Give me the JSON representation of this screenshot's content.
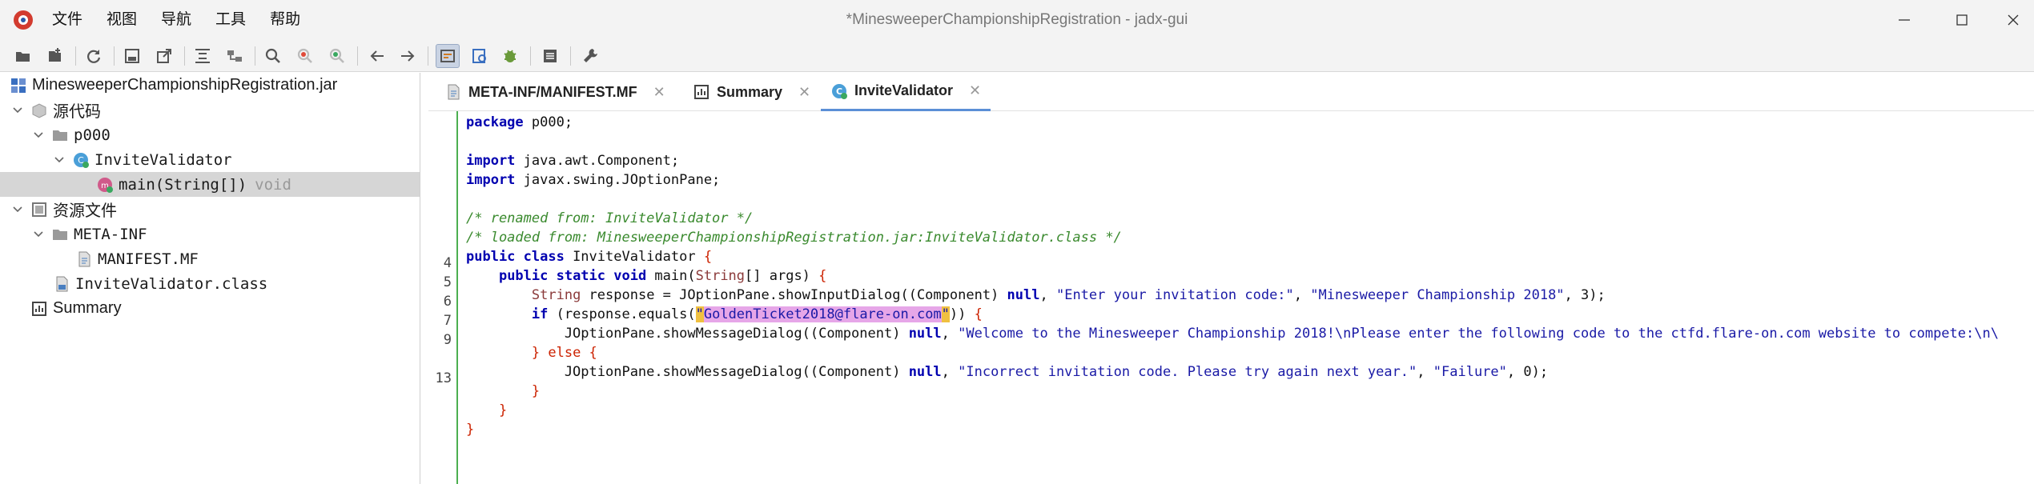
{
  "window": {
    "title": "*MinesweeperChampionshipRegistration - jadx-gui"
  },
  "menu": [
    "文件",
    "视图",
    "导航",
    "工具",
    "帮助"
  ],
  "toolbar": {
    "icons": [
      "open-file-icon",
      "add-files-icon",
      "reload-icon",
      "save-icon",
      "export-icon",
      "expand-icon",
      "sync-icon",
      "search-icon",
      "find-usage-icon",
      "goto-icon",
      "back-icon",
      "forward-icon",
      "deobfuscation-icon",
      "quick-tab-icon",
      "debug-icon",
      "log-icon",
      "preferences-icon"
    ]
  },
  "tree": {
    "root": "MinesweeperChampionshipRegistration.jar",
    "source_code": "源代码",
    "package": "p000",
    "class": "InviteValidator",
    "method": "main(String[])",
    "method_return": "void",
    "resources": "资源文件",
    "meta_inf": "META-INF",
    "manifest": "MANIFEST.MF",
    "class_file": "InviteValidator.class",
    "summary": "Summary"
  },
  "tabs": [
    {
      "label": "META-INF/MANIFEST.MF",
      "active": false
    },
    {
      "label": "Summary",
      "active": false
    },
    {
      "label": "InviteValidator",
      "active": true
    }
  ],
  "gutter": [
    "",
    "",
    "",
    "",
    "",
    "",
    "",
    "4",
    "5",
    "6",
    "7",
    "9",
    "",
    "13",
    "",
    "",
    ""
  ],
  "code": {
    "l1": [
      "package",
      " p000;"
    ],
    "l3": [
      "import",
      " java.awt.Component;"
    ],
    "l4": [
      "import",
      " javax.swing.JOptionPane;"
    ],
    "l6": "/* renamed from: InviteValidator */",
    "l7": "/* loaded from: MinesweeperChampionshipRegistration.jar:InviteValidator.class */",
    "l8": [
      "public class",
      " InviteValidator ",
      "{"
    ],
    "l9": [
      "    ",
      "public static void",
      " main(",
      "String",
      "[] args) ",
      "{"
    ],
    "l10": [
      "        ",
      "String",
      " response = JOptionPane.showInputDialog((Component) ",
      "null",
      ", ",
      "\"Enter your invitation code:\"",
      ", ",
      "\"Minesweeper Championship 2018\"",
      ", 3);"
    ],
    "l11": [
      "        ",
      "if",
      " (response.equals(",
      "\"",
      "GoldenTicket2018@flare-on.com",
      "\"",
      ")) ",
      "{"
    ],
    "l12": [
      "            JOptionPane.showMessageDialog((Component) ",
      "null",
      ", ",
      "\"Welcome to the Minesweeper Championship 2018!\\nPlease enter the following code to the ctfd.flare-on.com website to compete:\\n\\"
    ],
    "l13": [
      "        ",
      "} else {"
    ],
    "l14": [
      "            JOptionPane.showMessageDialog((Component) ",
      "null",
      ", ",
      "\"Incorrect invitation code. Please try again next year.\"",
      ", ",
      "\"Failure\"",
      ", 0);"
    ],
    "l15": "        }",
    "l16": "    }",
    "l17": "}"
  },
  "colors": {
    "keyword": "#0000b0",
    "comment": "#3a8a2e",
    "string": "#1a1aa6",
    "highlight": "#e6a6e8",
    "active_tab": "#5b8fd6",
    "gutter_line": "#4caf50"
  }
}
